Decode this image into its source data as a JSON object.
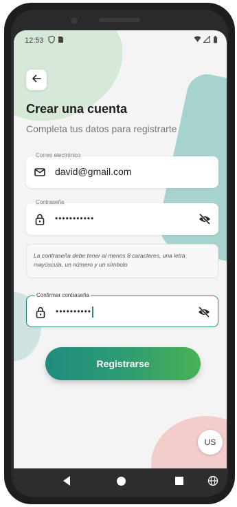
{
  "status_bar": {
    "time": "12:53"
  },
  "header": {
    "title": "Crear una cuenta",
    "subtitle": "Completa tus datos para registrarte"
  },
  "email": {
    "label": "Correo electrónico",
    "value": "david@gmail.com"
  },
  "password": {
    "label": "Contraseña",
    "value": "•••••••••••"
  },
  "password_hint": "La contraseña debe tener al menos 8 caracteres, una letra mayúscula, un número y un símbolo",
  "confirm_password": {
    "label": "Confirmar contraseña",
    "value": "••••••••••"
  },
  "register_button": "Registrarse",
  "user_badge": "US",
  "colors": {
    "accent": "#2b8a83",
    "gradient_start": "#1e8c7e",
    "gradient_end": "#48b255"
  }
}
